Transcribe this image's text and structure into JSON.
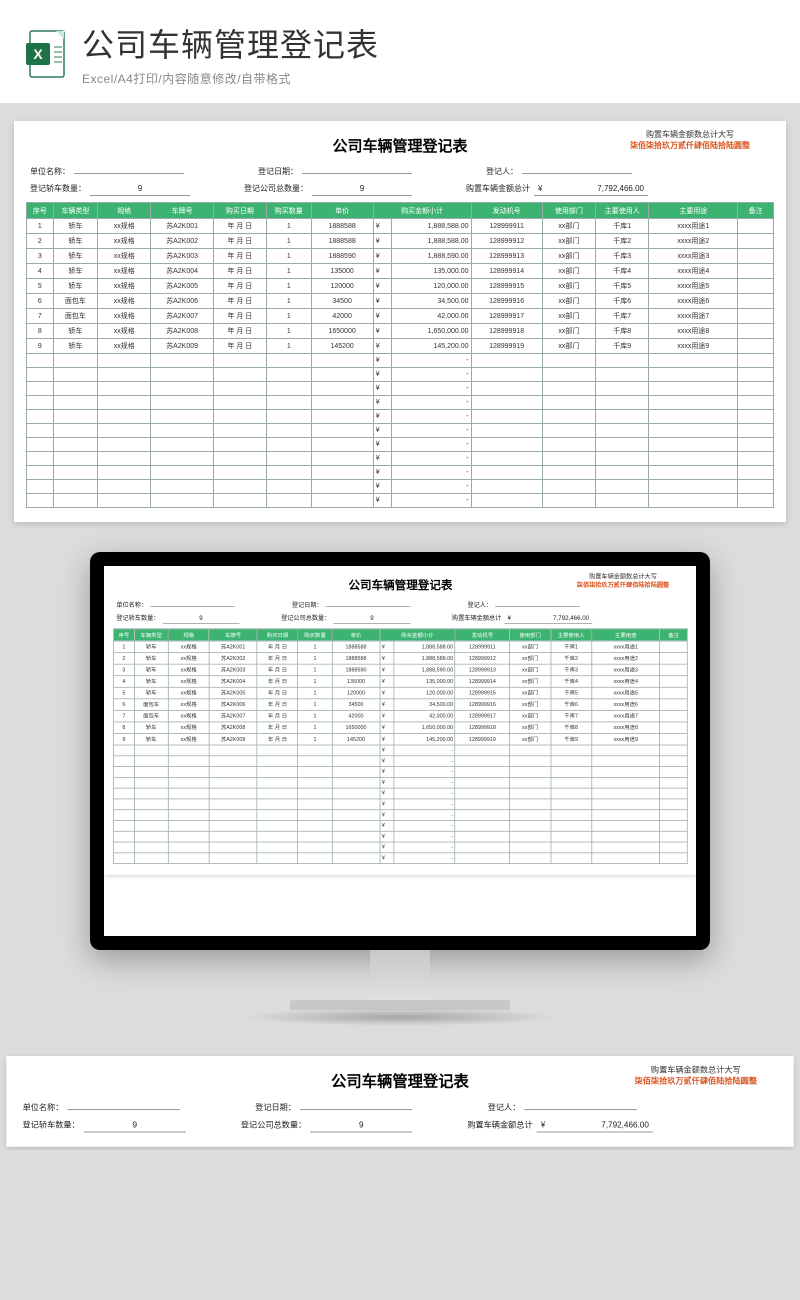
{
  "banner": {
    "title": "公司车辆管理登记表",
    "subtitle": "Excel/A4打印/内容随意修改/自带格式"
  },
  "sheet": {
    "title": "公司车辆管理登记表",
    "upper_label": "购置车辆金额数总计大写",
    "upper_value": "柒佰柒拾玖万贰仟肆佰陆拾陆圆整",
    "meta": {
      "unit_label": "单位名称：",
      "unit_val": "",
      "date_label": "登记日期：",
      "date_val": "",
      "person_label": "登记人：",
      "person_val": "",
      "car_count_label": "登记轿车数量：",
      "car_count_val": "9",
      "total_count_label": "登记公司总数量：",
      "total_count_val": "9",
      "total_amount_label": "购置车辆金额总计",
      "total_amount_sym": "¥",
      "total_amount_val": "7,792,466.00"
    },
    "headers": [
      "序号",
      "车辆类型",
      "规格",
      "车牌号",
      "购买日期",
      "购买数量",
      "单价",
      "购买金额小计",
      "",
      "发动机号",
      "使用部门",
      "主要使用人",
      "主要用途",
      "备注"
    ],
    "rows": [
      {
        "seq": "1",
        "type": "轿车",
        "spec": "xx规格",
        "plate": "苏A2K001",
        "date": "年 月 日",
        "qty": "1",
        "price": "1888588",
        "sym": "¥",
        "sub": "1,888,588.00",
        "eng": "128999911",
        "dept": "xx部门",
        "user": "千库1",
        "use": "xxxx用途1",
        "note": ""
      },
      {
        "seq": "2",
        "type": "轿车",
        "spec": "xx规格",
        "plate": "苏A2K002",
        "date": "年 月 日",
        "qty": "1",
        "price": "1888588",
        "sym": "¥",
        "sub": "1,888,588.00",
        "eng": "128999912",
        "dept": "xx部门",
        "user": "千库2",
        "use": "xxxx用途2",
        "note": ""
      },
      {
        "seq": "3",
        "type": "轿车",
        "spec": "xx规格",
        "plate": "苏A2K003",
        "date": "年 月 日",
        "qty": "1",
        "price": "1888590",
        "sym": "¥",
        "sub": "1,888,590.00",
        "eng": "128999913",
        "dept": "xx部门",
        "user": "千库3",
        "use": "xxxx用途3",
        "note": ""
      },
      {
        "seq": "4",
        "type": "轿车",
        "spec": "xx规格",
        "plate": "苏A2K004",
        "date": "年 月 日",
        "qty": "1",
        "price": "135000",
        "sym": "¥",
        "sub": "135,000.00",
        "eng": "128999914",
        "dept": "xx部门",
        "user": "千库4",
        "use": "xxxx用途4",
        "note": ""
      },
      {
        "seq": "5",
        "type": "轿车",
        "spec": "xx规格",
        "plate": "苏A2K005",
        "date": "年 月 日",
        "qty": "1",
        "price": "120000",
        "sym": "¥",
        "sub": "120,000.00",
        "eng": "128999915",
        "dept": "xx部门",
        "user": "千库5",
        "use": "xxxx用途5",
        "note": ""
      },
      {
        "seq": "6",
        "type": "面包车",
        "spec": "xx规格",
        "plate": "苏A2K006",
        "date": "年 月 日",
        "qty": "1",
        "price": "34500",
        "sym": "¥",
        "sub": "34,500.00",
        "eng": "128999916",
        "dept": "xx部门",
        "user": "千库6",
        "use": "xxxx用途6",
        "note": ""
      },
      {
        "seq": "7",
        "type": "面包车",
        "spec": "xx规格",
        "plate": "苏A2K007",
        "date": "年 月 日",
        "qty": "1",
        "price": "42000",
        "sym": "¥",
        "sub": "42,000.00",
        "eng": "128999917",
        "dept": "xx部门",
        "user": "千库7",
        "use": "xxxx用途7",
        "note": ""
      },
      {
        "seq": "8",
        "type": "轿车",
        "spec": "xx规格",
        "plate": "苏A2K008",
        "date": "年 月 日",
        "qty": "1",
        "price": "1650000",
        "sym": "¥",
        "sub": "1,650,000.00",
        "eng": "128999918",
        "dept": "xx部门",
        "user": "千库8",
        "use": "xxxx用途8",
        "note": ""
      },
      {
        "seq": "9",
        "type": "轿车",
        "spec": "xx规格",
        "plate": "苏A2K009",
        "date": "年 月 日",
        "qty": "1",
        "price": "145200",
        "sym": "¥",
        "sub": "145,200.00",
        "eng": "128999919",
        "dept": "xx部门",
        "user": "千库9",
        "use": "xxxx用途9",
        "note": ""
      }
    ],
    "empty_rows": 11,
    "empty_sym": "¥",
    "empty_sub": "-"
  }
}
